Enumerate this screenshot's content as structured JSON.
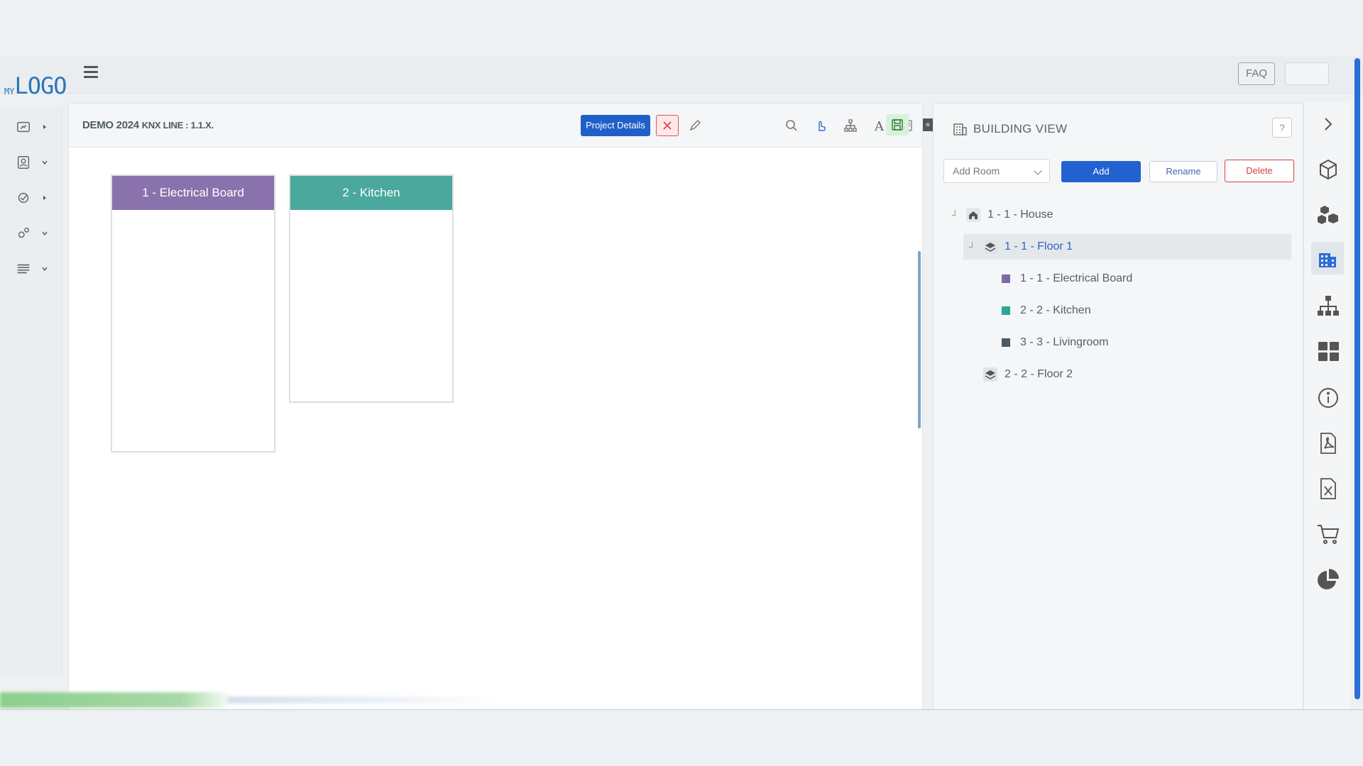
{
  "header": {
    "logo_prefix": "MY",
    "logo_text": "LOGO",
    "faq_label": "FAQ"
  },
  "project": {
    "name": "DEMO 2024",
    "line_label": "KNX LINE : 1.1.X.",
    "details_button": "Project Details"
  },
  "toolbar": {
    "icons": [
      "close-icon",
      "pencil-icon",
      "search-icon",
      "pointer-icon",
      "hierarchy-icon",
      "text-icon",
      "copy-icon",
      "paste-icon",
      "save-icon"
    ]
  },
  "rooms": [
    {
      "label": "1 - Electrical Board",
      "color": "#8a72ad"
    },
    {
      "label": "2 - Kitchen",
      "color": "#4aa89c"
    }
  ],
  "building_view": {
    "title": "BUILDING VIEW",
    "help": "?",
    "select_value": "Add Room",
    "add_label": "Add",
    "rename_label": "Rename",
    "delete_label": "Delete",
    "tree": [
      {
        "label": "1 - 1 - House",
        "type": "house"
      },
      {
        "label": "1 - 1 - Floor 1",
        "type": "floor",
        "selected": true
      },
      {
        "label": "1 - 1 - Electrical Board",
        "type": "room",
        "color": "#7c6aa6"
      },
      {
        "label": "2 - 2 - Kitchen",
        "type": "room",
        "color": "#2fa597"
      },
      {
        "label": "3 - 3 - Livingroom",
        "type": "room",
        "color": "#4b5b68"
      },
      {
        "label": "2 - 2 - Floor 2",
        "type": "floor"
      }
    ]
  },
  "right_strip": {
    "icons": [
      "chevron-right-icon",
      "cube-icon",
      "cubes-icon",
      "building-icon",
      "sitemap-icon",
      "grid-icon",
      "info-icon",
      "pdf-icon",
      "excel-icon",
      "cart-icon",
      "pie-chart-icon"
    ],
    "active": "building-icon"
  },
  "colors": {
    "primary": "#1f5fc9",
    "danger": "#d8423f",
    "save_bg": "#d7f2d9"
  }
}
